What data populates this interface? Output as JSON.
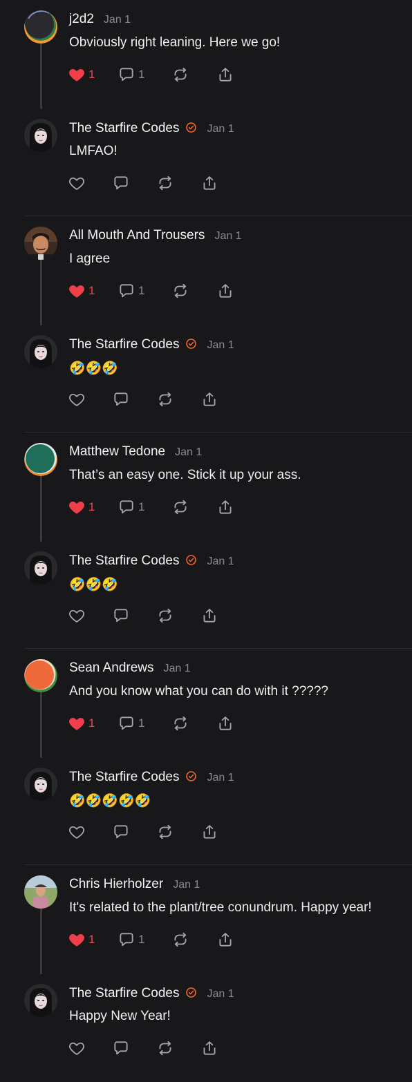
{
  "colors": {
    "background": "#18181a",
    "heart_active": "#ef3f4a",
    "verified": "#f26b2e",
    "muted": "#8a8a90"
  },
  "threads": [
    {
      "parent": {
        "author": "j2d2",
        "date": "Jan 1",
        "text": "Obviously right leaning. Here we go!",
        "avatar": "gradient-orange-green-dark",
        "liked": true,
        "like_count": "1",
        "reply_count": "1"
      },
      "reply": {
        "author": "The Starfire Codes",
        "verified": true,
        "date": "Jan 1",
        "text": "LMFAO!",
        "avatar": "portrait-woman-dark-hair",
        "liked": false
      }
    },
    {
      "parent": {
        "author": "All Mouth And Trousers",
        "date": "Jan 1",
        "text": "I agree",
        "avatar": "portrait-man-mustache",
        "liked": true,
        "like_count": "1",
        "reply_count": "1"
      },
      "reply": {
        "author": "The Starfire Codes",
        "verified": true,
        "date": "Jan 1",
        "text": "🤣🤣🤣",
        "avatar": "portrait-woman-dark-hair",
        "liked": false
      }
    },
    {
      "parent": {
        "author": "Matthew Tedone",
        "date": "Jan 1",
        "text": "That’s an easy one. Stick it up your ass.",
        "avatar": "gradient-green-teal-orange",
        "liked": true,
        "like_count": "1",
        "reply_count": "1"
      },
      "reply": {
        "author": "The Starfire Codes",
        "verified": true,
        "date": "Jan 1",
        "text": "🤣🤣🤣",
        "avatar": "portrait-woman-dark-hair",
        "liked": false
      }
    },
    {
      "parent": {
        "author": "Sean Andrews",
        "date": "Jan 1",
        "text": "And you know what you can do with it ?????",
        "avatar": "gradient-orange-green",
        "liked": true,
        "like_count": "1",
        "reply_count": "1"
      },
      "reply": {
        "author": "The Starfire Codes",
        "verified": true,
        "date": "Jan 1",
        "text": "🤣🤣🤣🤣🤣",
        "avatar": "portrait-woman-dark-hair",
        "liked": false
      }
    },
    {
      "parent": {
        "author": "Chris Hierholzer",
        "date": "Jan 1",
        "text": "It's related to the plant/tree conundrum. Happy year!",
        "avatar": "photo-man-outdoors",
        "liked": true,
        "like_count": "1",
        "reply_count": "1"
      },
      "reply": {
        "author": "The Starfire Codes",
        "verified": true,
        "date": "Jan 1",
        "text": "Happy New Year!",
        "avatar": "portrait-woman-dark-hair",
        "liked": false
      }
    }
  ],
  "icons": {
    "like": "heart-icon",
    "reply": "comment-bubble-icon",
    "restack": "restack-icon",
    "share": "share-icon",
    "verified": "verified-check-icon"
  }
}
